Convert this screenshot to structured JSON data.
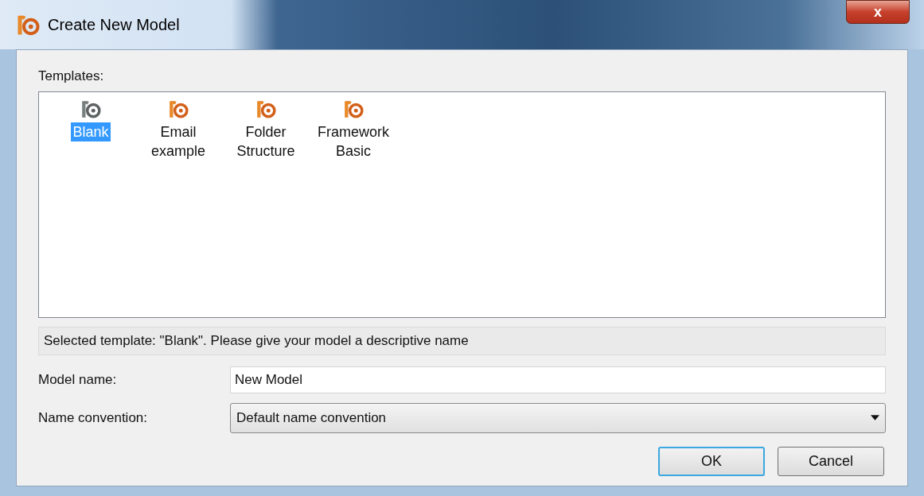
{
  "window": {
    "title": "Create New Model",
    "close": "x"
  },
  "templates_label": "Templates:",
  "templates": [
    {
      "label": "Blank",
      "selected": true
    },
    {
      "label": "Email\nexample",
      "selected": false
    },
    {
      "label": "Folder\nStructure",
      "selected": false
    },
    {
      "label": "Framework\nBasic",
      "selected": false
    }
  ],
  "status": "Selected template: \"Blank\". Please give your model a descriptive name",
  "model_name": {
    "label": "Model name:",
    "value": "New Model"
  },
  "name_convention": {
    "label": "Name convention:",
    "value": "Default name convention"
  },
  "buttons": [
    {
      "label": "OK",
      "default": true
    },
    {
      "label": "Cancel",
      "default": false
    }
  ]
}
